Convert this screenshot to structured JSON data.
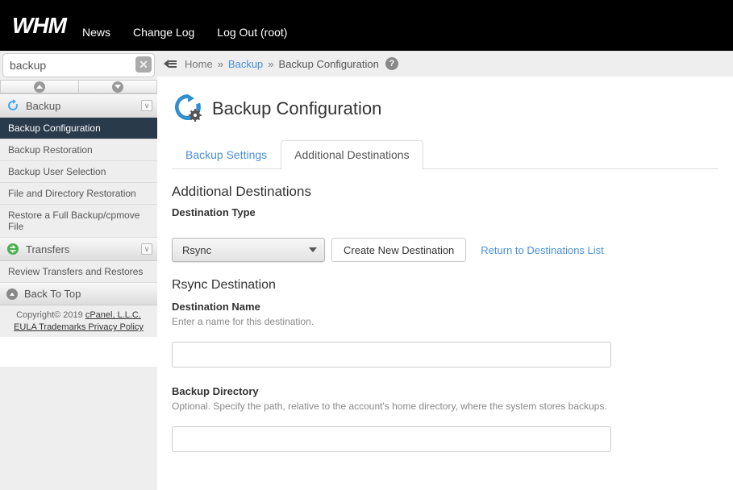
{
  "header": {
    "logo": "WHM",
    "nav": {
      "news": "News",
      "changelog": "Change Log",
      "logout": "Log Out (root)"
    }
  },
  "search": {
    "value": "backup",
    "placeholder": ""
  },
  "sidebar": {
    "sections": [
      {
        "label": "Backup",
        "items": [
          "Backup Configuration",
          "Backup Restoration",
          "Backup User Selection",
          "File and Directory Restoration",
          "Restore a Full Backup/cpmove File"
        ],
        "activeIndex": 0
      },
      {
        "label": "Transfers",
        "items": [
          "Review Transfers and Restores"
        ],
        "activeIndex": -1
      }
    ],
    "backToTop": "Back To Top"
  },
  "footer": {
    "copyright": "Copyright© 2019 ",
    "cpanel": "cPanel, L.L.C.",
    "eula": "EULA ",
    "trademarks": "Trademarks ",
    "privacy": "Privacy Policy"
  },
  "breadcrumb": {
    "home": "Home",
    "backup": "Backup",
    "current": "Backup Configuration",
    "sep": " » "
  },
  "page": {
    "title": "Backup Configuration",
    "tabs": {
      "settings": "Backup Settings",
      "destinations": "Additional Destinations"
    },
    "section": {
      "heading": "Additional Destinations",
      "destTypeLabel": "Destination Type",
      "destTypeValue": "Rsync",
      "createBtn": "Create New Destination",
      "returnLink": "Return to Destinations List"
    },
    "rsync": {
      "heading": "Rsync Destination",
      "nameLabel": "Destination Name",
      "nameDesc": "Enter a name for this destination.",
      "nameValue": "",
      "dirLabel": "Backup Directory",
      "dirDesc": "Optional. Specify the path, relative to the account's home directory, where the system stores backups.",
      "dirValue": ""
    }
  }
}
